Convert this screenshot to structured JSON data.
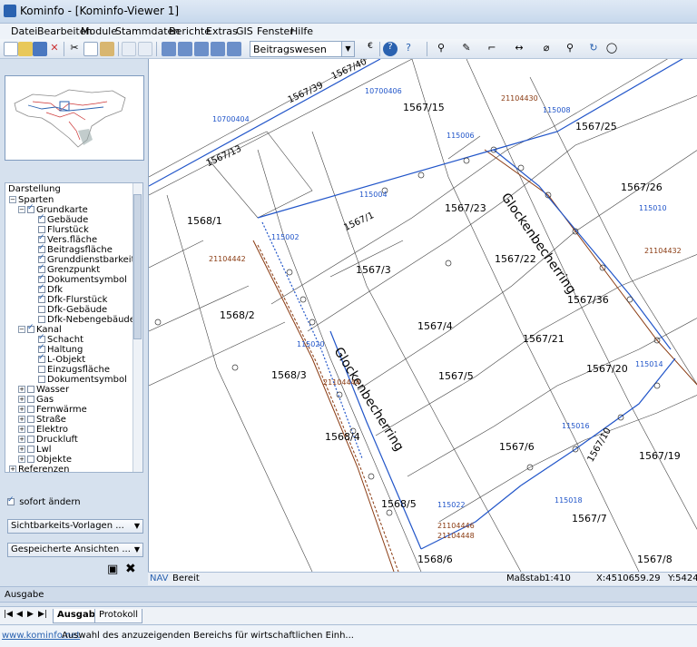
{
  "window": {
    "title": "Kominfo - [Kominfo-Viewer 1]"
  },
  "menu": [
    "Datei",
    "Bearbeiten",
    "Module",
    "Stammdaten",
    "Berichte",
    "Extras",
    "GIS",
    "Fenster",
    "Hilfe"
  ],
  "toolbar": {
    "layer_combo": "Beitragswesen"
  },
  "tree": {
    "root": "Darstellung",
    "nodes": [
      "Sparten",
      "Grundkarte",
      "Gebäude",
      "Flurstück",
      "Vers.fläche",
      "Beitragsfläche",
      "Grunddienstbarkeitsfläche",
      "Grenzpunkt",
      "Dokumentsymbol",
      "Dfk",
      "Dfk-Flurstück",
      "Dfk-Gebäude",
      "Dfk-Nebengebäude",
      "Kanal",
      "Schacht",
      "Haltung",
      "L-Objekt",
      "Einzugsfläche",
      "Dokumentsymbol",
      "Wasser",
      "Gas",
      "Fernwärme",
      "Straße",
      "Elektro",
      "Druckluft",
      "Lwl",
      "Objekte",
      "Referenzen"
    ]
  },
  "left_panel": {
    "sofort_label": "sofort ändern",
    "visibility_dropdown": "Sichtbarkeits-Vorlagen ...",
    "saved_views_dropdown": "Gespeicherte Ansichten ..."
  },
  "map": {
    "parcels": [
      "1567/40",
      "1567/39",
      "1567/15",
      "1567/25",
      "1567/13",
      "1567/26",
      "1567/23",
      "1567/1",
      "1568/1",
      "1567/22",
      "1567/3",
      "1567/36",
      "1568/2",
      "1567/4",
      "1567/21",
      "1567/20",
      "1568/3",
      "1567/5",
      "1568/4",
      "1567/6",
      "1567/19",
      "1567/10",
      "1568/5",
      "1567/7",
      "1568/6",
      "1567/8"
    ],
    "street_name": "Glockenbecherring",
    "blue_labels": [
      "10700406",
      "10700404",
      "115008",
      "115006",
      "115004",
      "115002",
      "115010",
      "115020",
      "115014",
      "115016",
      "115018",
      "115022"
    ],
    "brown_labels": [
      "21104430",
      "21104432",
      "21104442",
      "21104444",
      "21104446",
      "21104448"
    ]
  },
  "status": {
    "mode": "NAV",
    "state": "Bereit",
    "scale_label": "Maßstab",
    "scale_value": "1:410",
    "x": "X:4510659.29",
    "y": "Y:54249"
  },
  "ausgabe": "Ausgabe",
  "tabs": [
    "Ausgabe",
    "Protokoll"
  ],
  "bottom": {
    "url": "www.kominfo.net",
    "hint": "Auswahl des anzuzeigenden Bereichs für wirtschaftlichen Einh..."
  },
  "colors": {
    "accent": "#2a62b0",
    "pipe_blue": "#2155c9",
    "pipe_brown": "#8a3b12",
    "panel_bg": "#d6e1ee"
  }
}
